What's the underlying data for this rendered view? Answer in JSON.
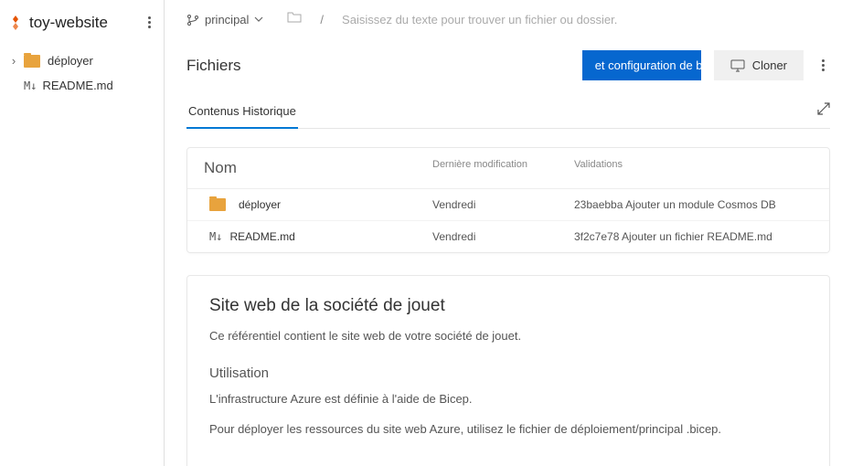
{
  "sidebar": {
    "repo_name": "toy-website",
    "tree": [
      {
        "type": "folder",
        "label": "déployer"
      },
      {
        "type": "md",
        "label": "README.md"
      }
    ]
  },
  "topbar": {
    "branch": "principal",
    "search_placeholder": "Saisissez du texte pour trouver un fichier ou dossier."
  },
  "header": {
    "title": "Fichiers",
    "config_button": "et configuration de b",
    "clone_button": "Cloner"
  },
  "tabs": {
    "t0": "Contenus",
    "t1": "Historique"
  },
  "table": {
    "head": {
      "name": "Nom",
      "mod": "Dernière modification",
      "commit": "Validations"
    },
    "rows": [
      {
        "type": "folder",
        "name": "déployer",
        "mod": "Vendredi",
        "commit": "23baebba Ajouter un module Cosmos DB"
      },
      {
        "type": "md",
        "name": "README.md",
        "mod": "Vendredi",
        "commit": "3f2c7e78 Ajouter un fichier README.md"
      }
    ]
  },
  "readme": {
    "title": "Site web de la société de jouet",
    "intro": "Ce référentiel contient le site web de votre société de jouet.",
    "h2": "Utilisation",
    "p1": "L'infrastructure Azure est définie à l'aide de Bicep.",
    "p2": "Pour déployer les ressources du site web Azure, utilisez le fichier de déploiement/principal .bicep."
  }
}
